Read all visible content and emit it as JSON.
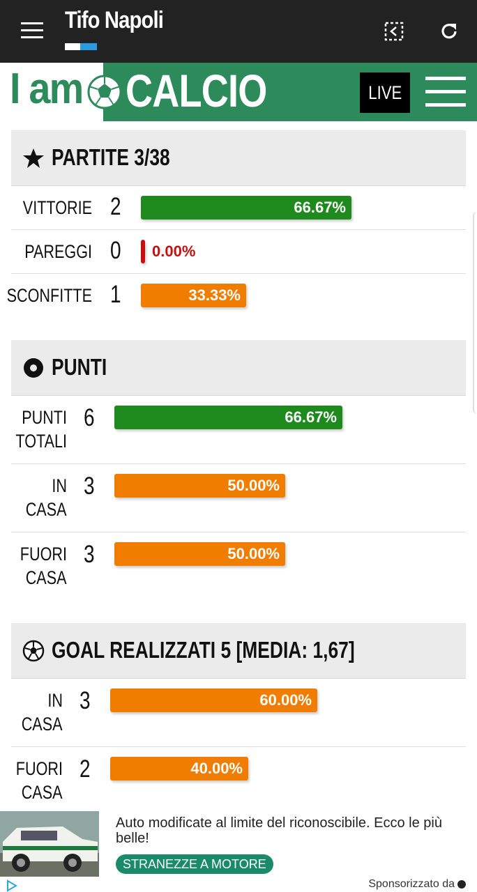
{
  "appbar": {
    "title": "Tifo Napoli",
    "flag_colors": [
      "#ffffff",
      "#2b9be0"
    ]
  },
  "brand": {
    "iam": "I am",
    "calcio": "CALCIO",
    "live_label": "LIVE",
    "colors": {
      "green": "#2d8a5a"
    }
  },
  "partite": {
    "title": "PARTITE 3/38",
    "icon": "star-icon",
    "rows": [
      {
        "label": "VITTORIE",
        "count": "2",
        "percent_text": "66.67%",
        "percent": 66.67,
        "color": "#1e8a1e"
      },
      {
        "label": "PAREGGI",
        "count": "0",
        "percent_text": "0.00%",
        "percent": 0,
        "color": "#c41010"
      },
      {
        "label": "SCONFITTE",
        "count": "1",
        "percent_text": "33.33%",
        "percent": 33.33,
        "color": "#f07d00"
      }
    ]
  },
  "punti": {
    "title": "PUNTI",
    "icon": "target-icon",
    "rows": [
      {
        "label_1": "PUNTI",
        "label_2": "TOTALI",
        "count": "6",
        "percent_text": "66.67%",
        "percent": 66.67,
        "color": "#1e8a1e"
      },
      {
        "label_1": "IN",
        "label_2": "CASA",
        "count": "3",
        "percent_text": "50.00%",
        "percent": 50,
        "color": "#f07d00"
      },
      {
        "label_1": "FUORI",
        "label_2": "CASA",
        "count": "3",
        "percent_text": "50.00%",
        "percent": 50,
        "color": "#f07d00"
      }
    ]
  },
  "goal": {
    "title": "GOAL REALIZZATI 5 [MEDIA: 1,67]",
    "icon": "soccer-ball-icon",
    "rows": [
      {
        "label_1": "IN",
        "label_2": "CASA",
        "count": "3",
        "percent_text": "60.00%",
        "percent": 60,
        "color": "#f07d00"
      },
      {
        "label_1": "FUORI",
        "label_2": "CASA",
        "count": "2",
        "percent_text": "40.00%",
        "percent": 40,
        "color": "#f07d00"
      }
    ]
  },
  "ad": {
    "text": "Auto modificate al limite del riconoscibile. Ecco le più belle!",
    "cta": "STRANEZZE A MOTORE",
    "sponsor": "Sponsorizzato da"
  }
}
